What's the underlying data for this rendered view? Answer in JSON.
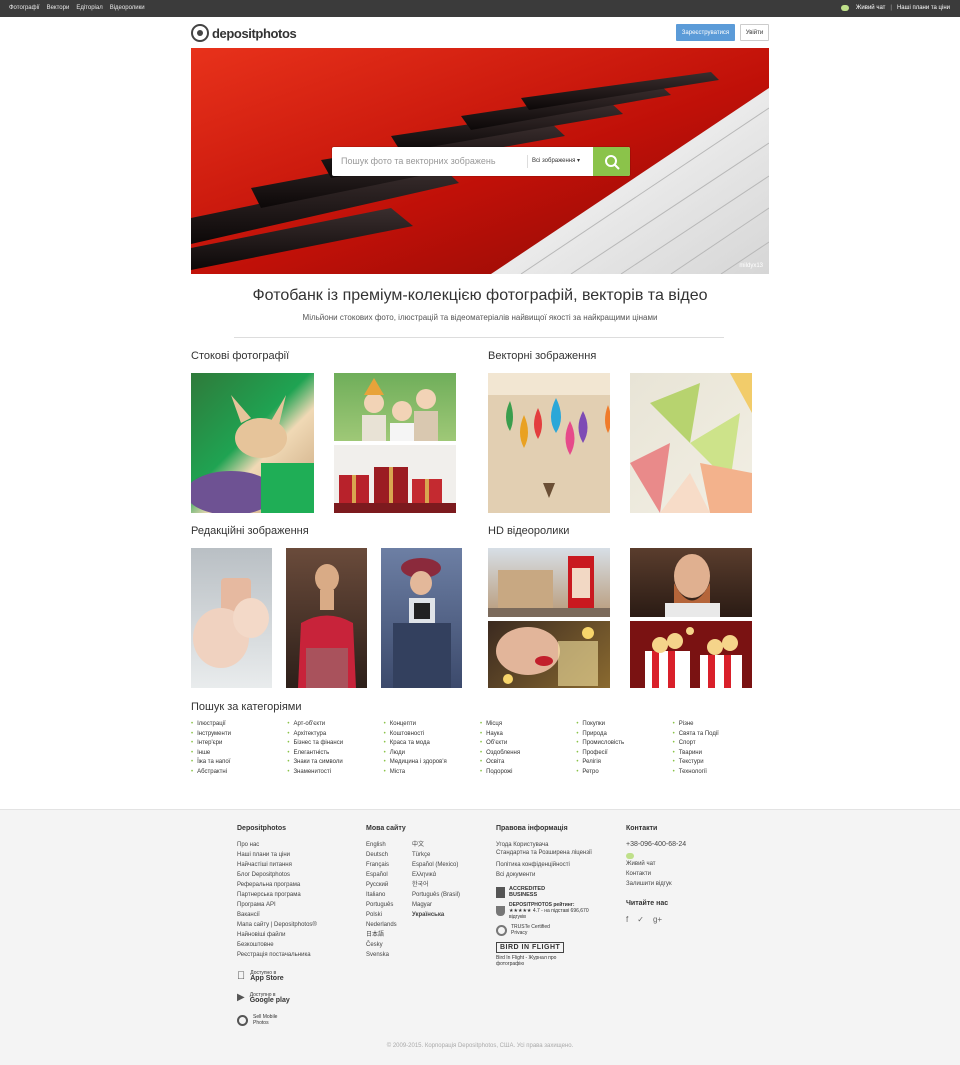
{
  "topbar": {
    "nav": [
      "Фотографії",
      "Вектори",
      "Едіторіал",
      "Відеоролики"
    ],
    "live_chat": "Живий чат",
    "sep": "|",
    "plans": "Наші плани та ціни"
  },
  "header": {
    "logo": "depositphotos",
    "register": "Зареєструватися",
    "login": "Увійти"
  },
  "hero": {
    "search_placeholder": "Пошук фото та векторних зображень",
    "filter": "Всі зображення",
    "credit": "mildyx13"
  },
  "tagline": "Фотобанк із преміум-колекцією фотографій, векторів та відео",
  "subtagline": "Мільйони стокових фото, ілюстрацій та відеоматеріалів найвищої якості за найкращими цінами",
  "sections": {
    "stock": "Стокові фотографії",
    "vector": "Векторні зображення",
    "editorial": "Редакційні зображення",
    "video": "HD відеоролики"
  },
  "categories": {
    "title": "Пошук за категоріями",
    "columns": [
      [
        "Ілюстрації",
        "Інструменти",
        "Інтер'єри",
        "Інше",
        "Їжа та напої",
        "Абстрактні"
      ],
      [
        "Арт-об'єкти",
        "Архітектура",
        "Бізнес та фінанси",
        "Елегантність",
        "Знаки та символи",
        "Знаменитості"
      ],
      [
        "Концепти",
        "Коштовності",
        "Краса та мода",
        "Люди",
        "Медицина і здоров'я",
        "Міста"
      ],
      [
        "Місця",
        "Наука",
        "Об'єкти",
        "Оздоблення",
        "Освіта",
        "Подорожі"
      ],
      [
        "Покупки",
        "Природа",
        "Промисловість",
        "Професії",
        "Релігія",
        "Ретро"
      ],
      [
        "Різне",
        "Свята та Події",
        "Спорт",
        "Тварини",
        "Текстури",
        "Технології"
      ]
    ]
  },
  "footer": {
    "col1": {
      "title": "Depositphotos",
      "links": [
        "Про нас",
        "Наші плани та ціни",
        "Найчастіші питання",
        "Блог Depositphotos",
        "Реферальна програма",
        "Партнерська програма",
        "Програма API",
        "Вакансії",
        "Мапа сайту | Depositphotos®",
        "Найновіші файли",
        "Безкоштовне",
        "Реєстрація постачальника"
      ],
      "app_store_small": "Доступно в",
      "app_store": "App Store",
      "google_small": "Доступно в",
      "google": "Google play",
      "sell": "Sell Mobile Photos"
    },
    "col2": {
      "title": "Мова сайту",
      "langs_a": [
        "English",
        "Deutsch",
        "Français",
        "Español",
        "Русский",
        "Italiano",
        "Português",
        "Polski",
        "Nederlands",
        "日本語",
        "Česky",
        "Svenska"
      ],
      "langs_b": [
        "中文",
        "Türkçe",
        "Español (Mexico)",
        "Ελληνικά",
        "한국어",
        "Português (Brasil)",
        "Magyar",
        "Українська"
      ]
    },
    "col3": {
      "title": "Правова інформація",
      "links": [
        "Угода Користувача",
        "Стандартна та Розширена ліцензії",
        "Політика конфіденційності",
        "Всі документи"
      ],
      "bbb": "ACCREDITED BUSINESS",
      "rating_title": "DEPOSITPHOTOS рейтинг:",
      "rating": "4.7 - на підставі 696,670 відгуків",
      "truste": "TRUSTe Certified Privacy",
      "bird": "BIRD IN FLIGHT",
      "bird_text": "Bird In Flight - Журнал про фотографію"
    },
    "col4": {
      "title": "Контакти",
      "phone": "+38-096-400-68-24",
      "chat": "Живий чат",
      "contacts": "Контакти",
      "feedback": "Залишити відгук",
      "follow": "Читайте нас"
    },
    "copyright": "© 2009-2015. Корпорація Depositphotos, США. Усі права захищено."
  }
}
